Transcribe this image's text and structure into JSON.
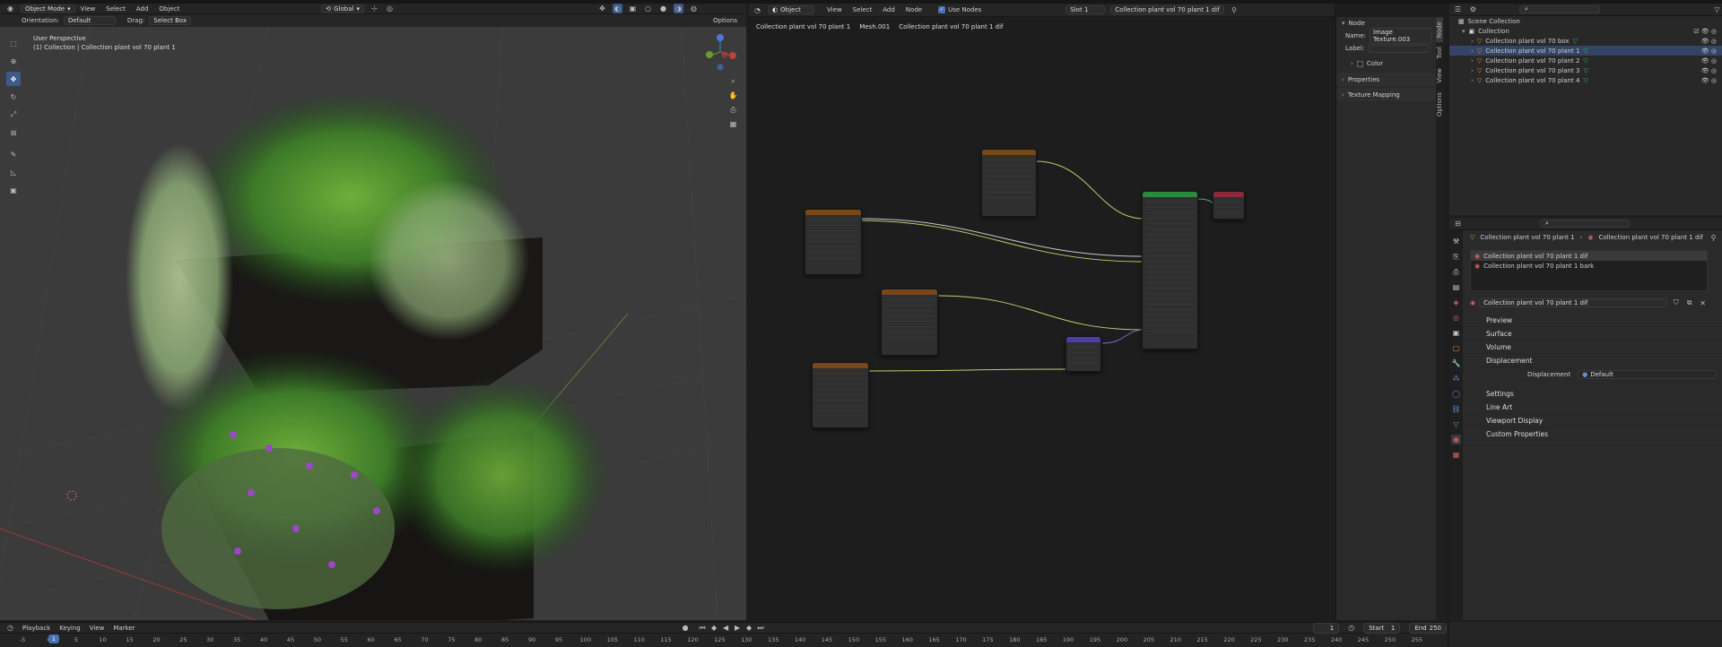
{
  "viewport": {
    "mode": "Object Mode",
    "menus": [
      "View",
      "Select",
      "Add",
      "Object"
    ],
    "transform": "Global",
    "orientation_label": "Orientation:",
    "orientation": "Default",
    "drag_label": "Drag:",
    "drag": "Select Box",
    "options": "Options",
    "persp": "User Perspective",
    "collection": "(1) Collection | Collection plant vol 70 plant 1"
  },
  "shader": {
    "object": "Object",
    "menus": [
      "View",
      "Select",
      "Add",
      "Node"
    ],
    "use_nodes": "Use Nodes",
    "slot": "Slot 1",
    "material": "Collection plant vol 70 plant 1 dif",
    "breadcrumb": [
      "Collection plant vol 70 plant 1",
      "Mesh.001",
      "Collection plant vol 70 plant 1 dif"
    ]
  },
  "npanel": {
    "section": "Node",
    "name_label": "Name:",
    "name": "Image Texture.003",
    "label_label": "Label:",
    "color": "Color",
    "properties": "Properties",
    "texture_mapping": "Texture Mapping",
    "tabs": [
      "Node",
      "Tool",
      "View",
      "Options"
    ]
  },
  "outliner": {
    "root": "Scene Collection",
    "collection": "Collection",
    "items": [
      "Collection plant vol 70 box",
      "Collection plant vol 70 plant 1",
      "Collection plant vol 70 plant 2",
      "Collection plant vol 70 plant 3",
      "Collection plant vol 70 plant 4"
    ]
  },
  "props": {
    "breadcrumb": [
      "Collection plant vol 70 plant 1",
      "Collection plant vol 70 plant 1 dif"
    ],
    "slots": [
      "Collection plant vol 70 plant 1 dif",
      "Collection plant vol 70 plant 1 bark"
    ],
    "material": "Collection plant vol 70 plant 1 dif",
    "sections": [
      "Preview",
      "Surface",
      "Volume",
      "Displacement"
    ],
    "displacement_label": "Displacement",
    "displacement": "Default",
    "sections2": [
      "Settings",
      "Line Art",
      "Viewport Display",
      "Custom Properties"
    ]
  },
  "timeline": {
    "menus": [
      "Playback",
      "Keying",
      "View",
      "Marker"
    ],
    "current": "1",
    "start_label": "Start",
    "start": "1",
    "end_label": "End",
    "end": "250",
    "ticks": [
      "-5",
      "0",
      "5",
      "10",
      "15",
      "20",
      "25",
      "30",
      "35",
      "40",
      "45",
      "50",
      "55",
      "60",
      "65",
      "70",
      "75",
      "80",
      "85",
      "90",
      "95",
      "100",
      "105",
      "110",
      "115",
      "120",
      "125",
      "130",
      "135",
      "140",
      "145",
      "150",
      "155",
      "160",
      "165",
      "170",
      "175",
      "180",
      "185",
      "190",
      "195",
      "200",
      "205",
      "210",
      "215",
      "220",
      "225",
      "230",
      "235",
      "240",
      "245",
      "250",
      "255"
    ]
  }
}
